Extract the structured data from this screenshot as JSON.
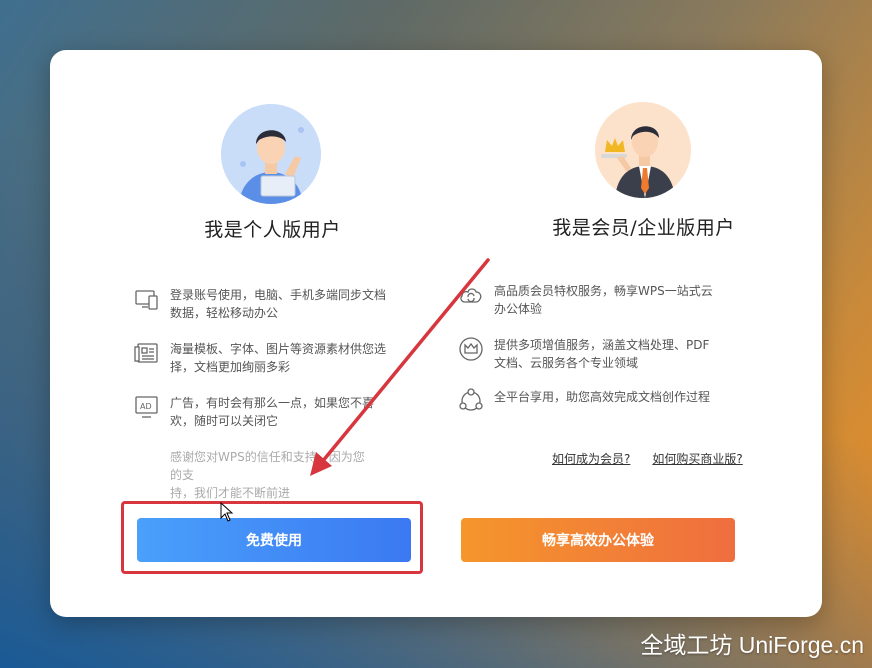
{
  "left": {
    "title": "我是个人版用户",
    "features": [
      {
        "icon": "devices-icon",
        "line1": "登录账号使用，电脑、手机多端同步文档",
        "line2": "数据，轻松移动办公"
      },
      {
        "icon": "template-icon",
        "line1": "海量模板、字体、图片等资源素材供您选",
        "line2": "择，文档更加绚丽多彩"
      },
      {
        "icon": "ad-icon",
        "line1": "广告，有时会有那么一点，如果您不喜",
        "line2": "欢，随时可以关闭它"
      }
    ],
    "note_line1": "感谢您对WPS的信任和支持，因为您的支",
    "note_line2": "持，我们才能不断前进",
    "button_label": "免费使用"
  },
  "right": {
    "title": "我是会员/企业版用户",
    "features": [
      {
        "icon": "cloud-icon",
        "line1": "高品质会员特权服务，畅享WPS一站式云",
        "line2": "办公体验"
      },
      {
        "icon": "crown-icon",
        "line1": "提供多项增值服务，涵盖文档处理、PDF",
        "line2": "文档、云服务各个专业领域"
      },
      {
        "icon": "platform-icon",
        "line1": "全平台享用，助您高效完成文档创作过程",
        "line2": ""
      }
    ],
    "link_member": "如何成为会员?",
    "link_business": "如何购买商业版?",
    "button_label": "畅享高效办公体验"
  },
  "annotation": {
    "color": "#d8363e"
  },
  "watermark": "全域工坊 UniForge.cn"
}
